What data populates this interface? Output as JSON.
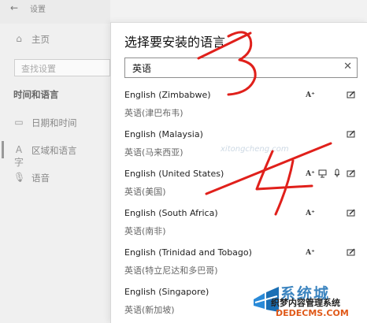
{
  "settings": {
    "title": "设置",
    "nav": {
      "home_label": "主页",
      "search_placeholder": "查找设置",
      "section_title": "时间和语言",
      "items": [
        {
          "label": "日期和时间",
          "icon": "calendar-icon"
        },
        {
          "label": "区域和语言",
          "icon": "language-icon"
        },
        {
          "label": "语音",
          "icon": "microphone-icon"
        }
      ]
    }
  },
  "dialog": {
    "title": "选择要安装的语言",
    "search_value": "英语",
    "clear_glyph": "✕",
    "languages": [
      {
        "name": "English (Zimbabwe)",
        "native": "英语(津巴布韦)"
      },
      {
        "name": "English (Malaysia)",
        "native": "英语(马来西亚)"
      },
      {
        "name": "English (United States)",
        "native": "英语(美国)"
      },
      {
        "name": "English (South Africa)",
        "native": "英语(南非)"
      },
      {
        "name": "English (Trinidad and Tobago)",
        "native": "英语(特立尼达和多巴哥)"
      },
      {
        "name": "English (Singapore)",
        "native": "英语(新加坡)"
      }
    ],
    "feature_icons": [
      "font-icon",
      "text-to-speech-icon",
      "speech-recognition-icon",
      "handwriting-icon"
    ]
  },
  "annotations": {
    "step_3": "3",
    "step_4": "4",
    "color": "#e0201b"
  },
  "watermark": {
    "brand": "系统城",
    "line2": "织梦内容管理系统",
    "line3": "DEDECMS.COM",
    "ghost": "xitongcheng.com"
  }
}
